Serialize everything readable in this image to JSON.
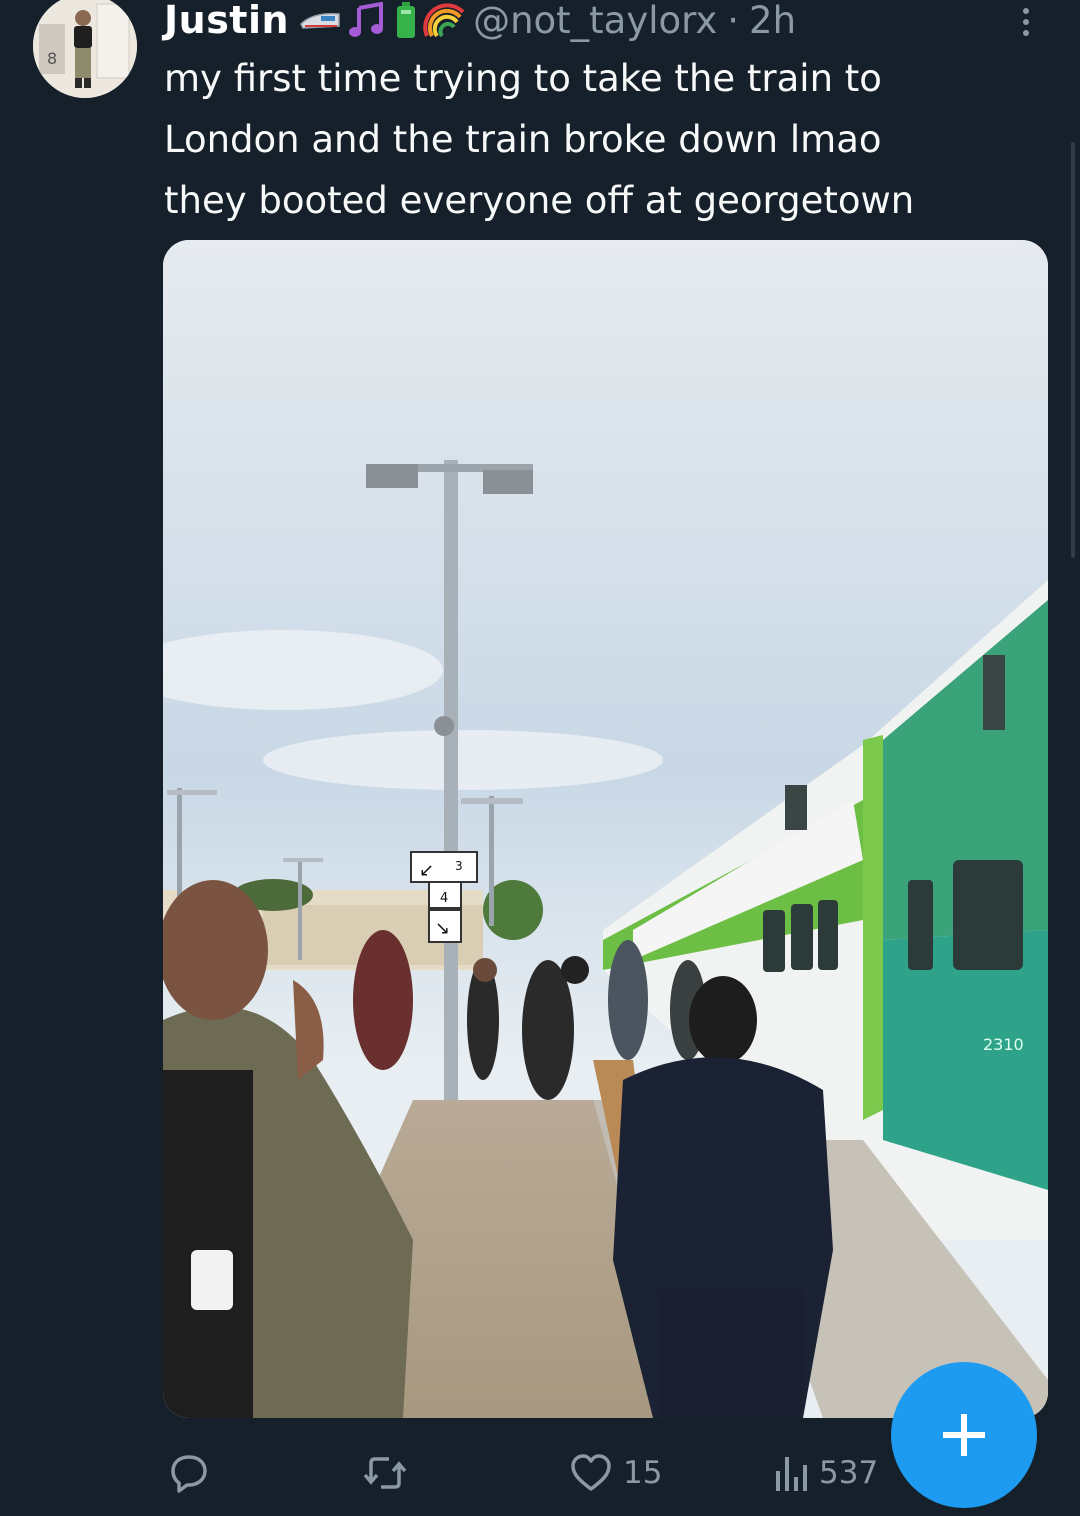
{
  "tweet": {
    "author_name": "Justin",
    "handle": "@not_taylorx",
    "separator": "·",
    "time": "2h",
    "name_emojis": [
      "train-emoji",
      "music-notes-emoji",
      "battery-emoji",
      "rainbow-emoji"
    ],
    "text_lines": [
      "my first time trying to take the train to",
      "London and the train broke down lmao",
      "they booted everyone off at georgetown"
    ],
    "photo_description_icon": "train-platform-photo"
  },
  "photo_signs": {
    "platform_3": "3",
    "platform_4": "4",
    "car_number": "2310"
  },
  "actions": {
    "reply_count": "",
    "retweet_count": "",
    "like_count": "15",
    "views_count": "537"
  },
  "fab": {
    "icon": "plus-icon"
  },
  "colors": {
    "background": "#15202b",
    "secondary_text": "#8b98a5",
    "accent": "#1d9bf0"
  }
}
